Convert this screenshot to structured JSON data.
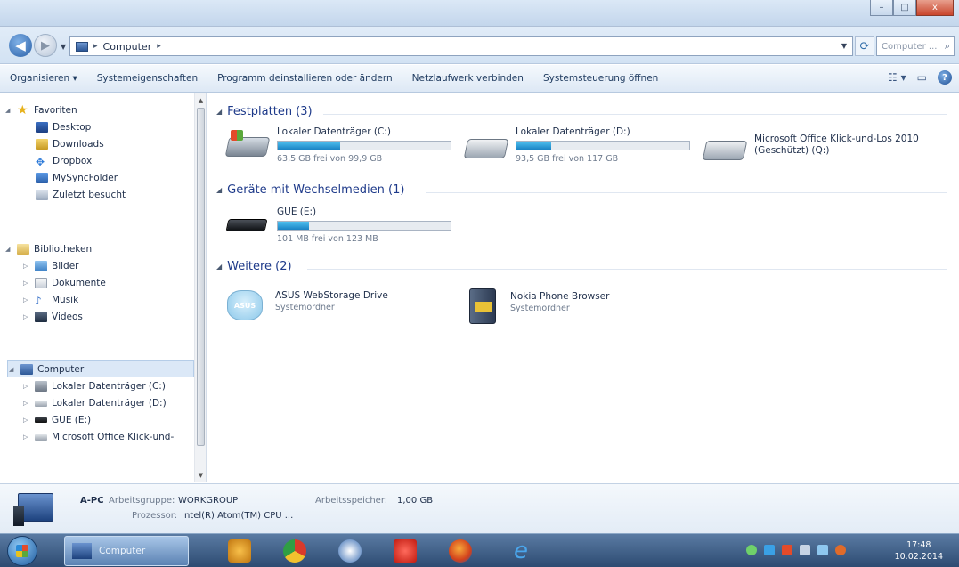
{
  "window": {
    "title_buttons": [
      "–",
      "□",
      "x"
    ]
  },
  "address": {
    "path": [
      "Computer"
    ],
    "search_placeholder": "Computer ..."
  },
  "toolbar": {
    "organize": "Organisieren ▾",
    "system_properties": "Systemeigenschaften",
    "uninstall": "Programm deinstallieren oder ändern",
    "map_drive": "Netzlaufwerk verbinden",
    "control_panel": "Systemsteuerung öffnen"
  },
  "nav": {
    "favorites": {
      "label": "Favoriten",
      "items": [
        "Desktop",
        "Downloads",
        "Dropbox",
        "MySyncFolder",
        "Zuletzt besucht"
      ]
    },
    "libraries": {
      "label": "Bibliotheken",
      "items": [
        "Bilder",
        "Dokumente",
        "Musik",
        "Videos"
      ]
    },
    "computer": {
      "label": "Computer",
      "items": [
        "Lokaler Datenträger (C:)",
        "Lokaler Datenträger (D:)",
        "GUE (E:)",
        "Microsoft Office Klick-und-"
      ]
    }
  },
  "content": {
    "hard_disks": {
      "header": "Festplatten (3)",
      "drives": [
        {
          "name": "Lokaler Datenträger (C:)",
          "free": "63,5 GB frei von 99,9 GB",
          "used_fraction": 0.36
        },
        {
          "name": "Lokaler Datenträger (D:)",
          "free": "93,5 GB frei von 117 GB",
          "used_fraction": 0.2
        },
        {
          "name": "Microsoft Office Klick-und-Los 2010 (Geschützt) (Q:)"
        }
      ]
    },
    "removable": {
      "header": "Geräte mit Wechselmedien (1)",
      "drives": [
        {
          "name": "GUE (E:)",
          "free": "101 MB frei von 123 MB",
          "used_fraction": 0.18
        }
      ]
    },
    "other": {
      "header": "Weitere (2)",
      "items": [
        {
          "name": "ASUS WebStorage Drive",
          "type": "Systemordner"
        },
        {
          "name": "Nokia Phone Browser",
          "type": "Systemordner"
        }
      ]
    }
  },
  "details": {
    "pc_name": "A-PC",
    "workgroup_label": "Arbeitsgruppe:",
    "workgroup_value": "WORKGROUP",
    "memory_label": "Arbeitsspeicher:",
    "memory_value": "1,00 GB",
    "processor_label": "Prozessor:",
    "processor_value": "Intel(R) Atom(TM) CPU ..."
  },
  "taskbar": {
    "explorer_label": "Computer",
    "time": "17:48",
    "date": "10.02.2014"
  },
  "colors": {
    "accent": "#1e3a8a",
    "bar_fill": "#26a0da",
    "taskbar": "#2d4b72"
  }
}
